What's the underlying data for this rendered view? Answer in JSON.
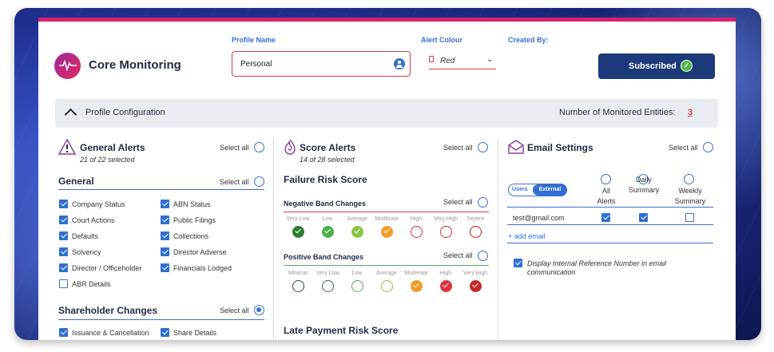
{
  "header": {
    "app_title": "Core Monitoring",
    "profile_name_label": "Profile Name",
    "profile_name_value": "Personal",
    "alert_colour_label": "Alert Colour",
    "alert_colour_value": "Red",
    "created_by_label": "Created By:",
    "subscribe_label": "Subscribed",
    "accent_color": "#e0245e",
    "button_color": "#1c3a7a"
  },
  "config_bar": {
    "title": "Profile Configuration",
    "monitored_label": "Number of Monitored Entities:",
    "monitored_count": "3"
  },
  "general_alerts": {
    "title": "General Alerts",
    "subtitle": "21 of 22 selected",
    "select_all": "Select all",
    "general_title": "General",
    "general_select_all": "Select all",
    "general_items": [
      {
        "label": "Company Status",
        "checked": true
      },
      {
        "label": "ABN Status",
        "checked": true
      },
      {
        "label": "Court Actions",
        "checked": true
      },
      {
        "label": "Public Filings",
        "checked": true
      },
      {
        "label": "Defaults",
        "checked": true
      },
      {
        "label": "Collections",
        "checked": true
      },
      {
        "label": "Solvency",
        "checked": true
      },
      {
        "label": "Director Adverse",
        "checked": true
      },
      {
        "label": "Director / Officeholder",
        "checked": true
      },
      {
        "label": "Financials Lodged",
        "checked": true
      },
      {
        "label": "ABR Details",
        "checked": false
      }
    ],
    "shareholder_title": "Shareholder Changes",
    "shareholder_select_all": "Select all",
    "shareholder_items": [
      {
        "label": "Issuance & Cancellation",
        "checked": true
      },
      {
        "label": "Share Details",
        "checked": true
      }
    ]
  },
  "score_alerts": {
    "title": "Score Alerts",
    "subtitle": "14 of 28 selected",
    "select_all": "Select all",
    "failure_title": "Failure Risk Score",
    "negative_title": "Negative Band Changes",
    "negative_select_all": "Select all",
    "negative_bands": [
      {
        "label": "Very Low",
        "color": "#2e7d32",
        "filled": true
      },
      {
        "label": "Low",
        "color": "#4caf50",
        "filled": true
      },
      {
        "label": "Average",
        "color": "#8bc34a",
        "filled": true
      },
      {
        "label": "Moderate",
        "color": "#f39c2b",
        "filled": true
      },
      {
        "label": "High",
        "color": "#e0303a",
        "filled": false
      },
      {
        "label": "Very High",
        "color": "#d32f2f",
        "filled": false
      },
      {
        "label": "Severe",
        "color": "#b71c1c",
        "filled": false
      }
    ],
    "positive_title": "Positive Band Changes",
    "positive_select_all": "Select all",
    "positive_bands": [
      {
        "label": "Minimal",
        "color": "#1b5e20",
        "filled": false
      },
      {
        "label": "Very Low",
        "color": "#2e7d32",
        "filled": false
      },
      {
        "label": "Low",
        "color": "#4caf50",
        "filled": false
      },
      {
        "label": "Average",
        "color": "#8bc34a",
        "filled": false
      },
      {
        "label": "Moderate",
        "color": "#f39c2b",
        "filled": true
      },
      {
        "label": "High",
        "color": "#e0303a",
        "filled": true
      },
      {
        "label": "Very High",
        "color": "#c62828",
        "filled": true
      }
    ],
    "late_payment_title": "Late Payment Risk Score"
  },
  "email_settings": {
    "title": "Email Settings",
    "select_all": "Select all",
    "toggle_users": "Users",
    "toggle_external": "External",
    "col_all": "All\nAlerts",
    "col_daily": "Daily\nSummary",
    "col_weekly": "Weekly\nSummary",
    "email": "test@gmail.com",
    "row_all": true,
    "row_daily": true,
    "row_weekly": false,
    "add_email": "+ add email",
    "internal_ref_label": "Display Internal Reference Number in email communication",
    "internal_ref_checked": true
  }
}
